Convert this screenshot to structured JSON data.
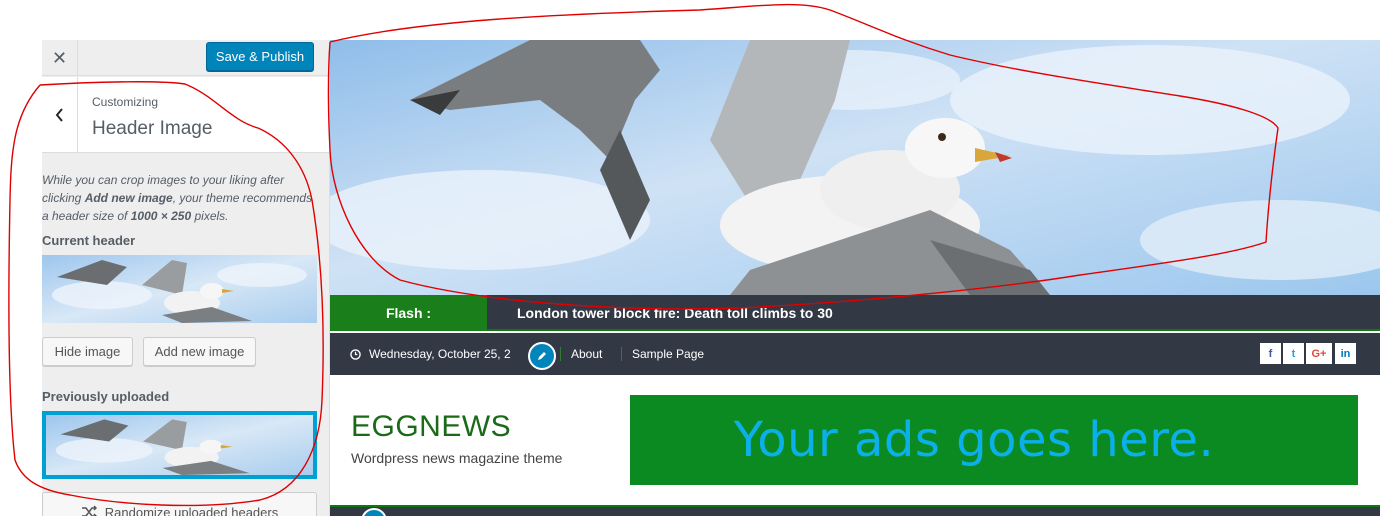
{
  "sidebar": {
    "close_symbol": "✕",
    "publish_label": "Save & Publish",
    "breadcrumb": "Customizing",
    "title": "Header Image",
    "description_parts": {
      "p1": "While you can crop images to your liking after clicking ",
      "b1": "Add new image",
      "p2": ", your theme recommends a header size of ",
      "b2": "1000 × 250",
      "p3": " pixels."
    },
    "current_header_label": "Current header",
    "hide_image_label": "Hide image",
    "add_new_image_label": "Add new image",
    "previously_uploaded_label": "Previously uploaded",
    "randomize_label": "Randomize uploaded headers"
  },
  "preview": {
    "flash_label": "Flash :",
    "flash_headline": "London tower block fire: Death toll climbs to 30",
    "date": "Wednesday, October 25, 2",
    "nav": [
      "About",
      "Sample Page"
    ],
    "social": [
      {
        "icon": "facebook-icon",
        "glyph": "f",
        "color": "#3b5998"
      },
      {
        "icon": "twitter-icon",
        "glyph": "t",
        "color": "#1da1f2"
      },
      {
        "icon": "google-plus-icon",
        "glyph": "G+",
        "color": "#dd4b39"
      },
      {
        "icon": "linkedin-icon",
        "glyph": "in",
        "color": "#0077b5"
      }
    ],
    "site_title": "EGGNEWS",
    "tagline": "Wordpress news magazine theme",
    "ad_text": "Your ads goes here."
  },
  "colors": {
    "publish_blue": "#0085ba",
    "flash_green": "#1a7f1a",
    "nav_dark": "#333845",
    "ad_green": "#0c8a22",
    "ad_text": "#0bb0ea",
    "annotation_red": "#e00000"
  }
}
